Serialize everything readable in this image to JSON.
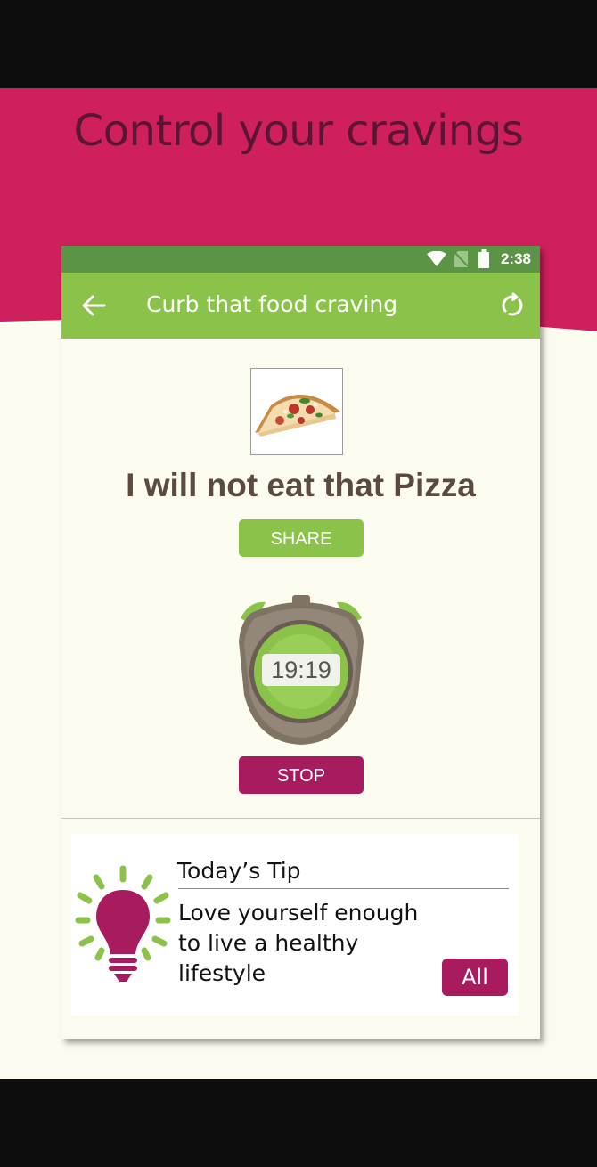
{
  "headline": "Control your cravings",
  "status_bar": {
    "time": "2:38"
  },
  "app_bar": {
    "title": "Curb that food craving"
  },
  "pledge": "I will not eat that Pizza",
  "buttons": {
    "share": "SHARE",
    "stop": "STOP"
  },
  "timer": {
    "display": "19:19"
  },
  "tip": {
    "title": "Today’s Tip",
    "lines": [
      "Love yourself enough",
      "to live a healthy",
      "lifestyle"
    ],
    "all_label": "All"
  },
  "colors": {
    "brand_magenta": "#cf1f5d",
    "headline_text": "#5a1535",
    "app_bar_green": "#8bc34a",
    "status_bar_green": "#5a9444",
    "stop_button": "#a81c5f",
    "background": "#fcfbf0"
  }
}
